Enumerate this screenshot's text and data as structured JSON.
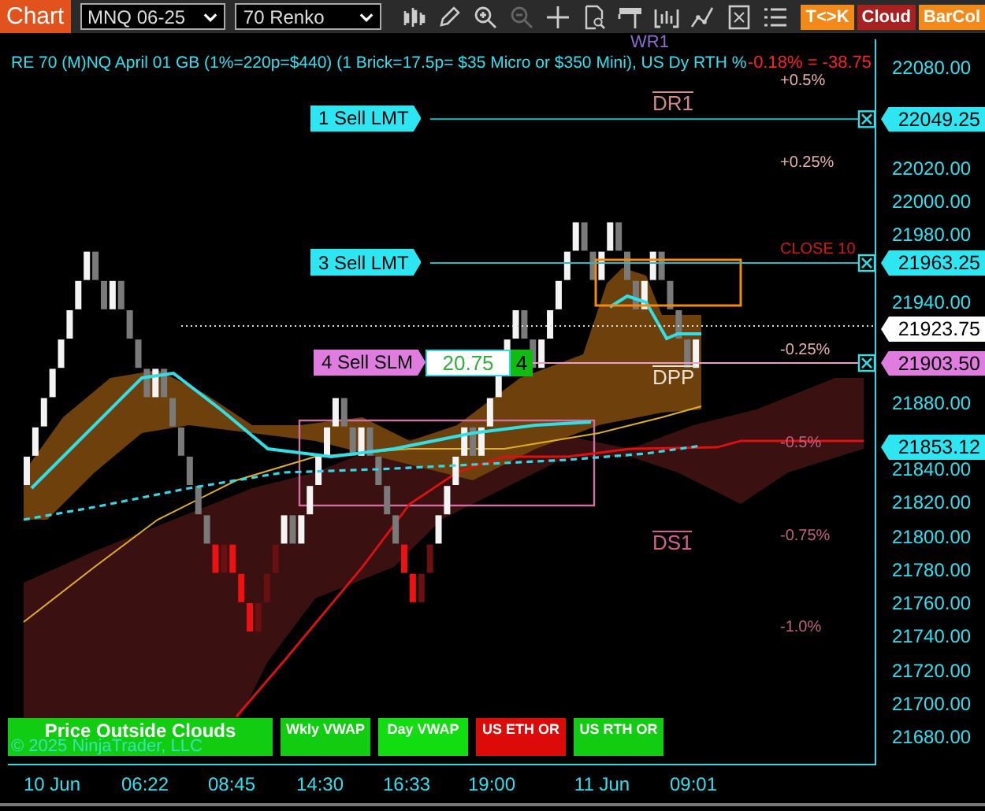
{
  "toolbar": {
    "title": "Chart",
    "instrument": "MNQ 06-25",
    "period": "70 Renko",
    "buttons": [
      {
        "label": "T<>K",
        "color": "#f28a1a"
      },
      {
        "label": "Cloud",
        "color": "#a82020"
      },
      {
        "label": "BarCol",
        "color": "#f28a1a"
      }
    ]
  },
  "chart": {
    "header": "RE 70 (M)NQ April 01 GB (1%=220p=$440) (1 Brick=17.5p= $35 Micro or $350 Mini), US Dy RTH %",
    "pivot_top": "WR1",
    "pnl": "-0.18% = -38.75",
    "percent_labels": [
      "+0.5%",
      "+0.25%",
      "-0.25%",
      "-0.5%",
      "-0.75%",
      "-1.0%"
    ],
    "pivots": [
      "DR1",
      "DPP",
      "DS1"
    ],
    "close_note": "CLOSE 10",
    "orders": [
      {
        "label": "1 Sell LMT",
        "price": "22049.25",
        "kind": "limit"
      },
      {
        "label": "3 Sell LMT",
        "price": "21963.25",
        "kind": "limit"
      },
      {
        "label": "4 Sell SLM",
        "price": "21903.50",
        "kind": "stop",
        "profit": "20.75",
        "quantity": "4"
      }
    ],
    "indicators": [
      {
        "label": "Price Outside Clouds",
        "color": "#11cc11"
      },
      {
        "label": "Wkly VWAP",
        "color": "#11cc11"
      },
      {
        "label": "Day VWAP",
        "color": "#11dd11"
      },
      {
        "label": "US ETH OR",
        "color": "#dd0a0a"
      },
      {
        "label": "US RTH OR",
        "color": "#11cc11"
      }
    ],
    "copyright": "© 2025 NinjaTrader, LLC"
  },
  "price_axis": {
    "ticks": [
      "22080.00",
      "22020.00",
      "22000.00",
      "21980.00",
      "21940.00",
      "21880.00",
      "21840.00",
      "21820.00",
      "21800.00",
      "21780.00",
      "21760.00",
      "21740.00",
      "21720.00",
      "21700.00",
      "21680.00"
    ],
    "last_price": "21923.75",
    "marker_price": "21853.12"
  },
  "time_axis": [
    "10 Jun",
    "06:22",
    "08:45",
    "14:30",
    "16:33",
    "19:00",
    "11 Jun",
    "09:01"
  ]
}
